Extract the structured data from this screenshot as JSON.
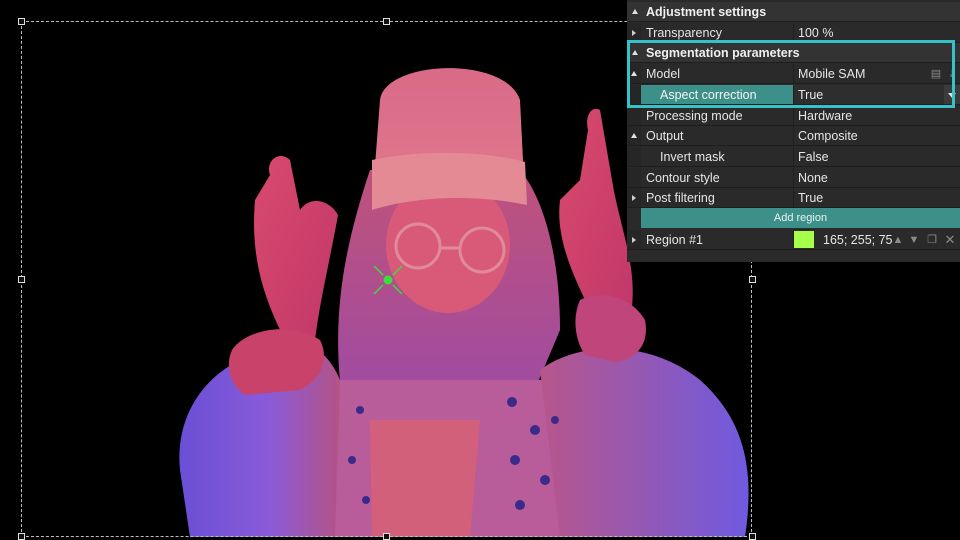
{
  "panel": {
    "sections": {
      "adjustment": "Adjustment settings",
      "segmentation": "Segmentation parameters"
    },
    "rows": {
      "transparency": {
        "label": "Transparency",
        "value": "100 %"
      },
      "model": {
        "label": "Model",
        "value": "Mobile SAM"
      },
      "aspect_correction": {
        "label": "Aspect correction",
        "value": "True"
      },
      "processing_mode": {
        "label": "Processing mode",
        "value": "Hardware"
      },
      "output": {
        "label": "Output",
        "value": "Composite"
      },
      "invert_mask": {
        "label": "Invert mask",
        "value": "False"
      },
      "contour_style": {
        "label": "Contour style",
        "value": "None"
      },
      "post_filtering": {
        "label": "Post filtering",
        "value": "True"
      }
    },
    "add_region_label": "Add region",
    "region": {
      "label": "Region #1",
      "value": "165; 255; 75",
      "color": "#a5ff4b"
    }
  },
  "colors": {
    "accent": "#3d8f8a",
    "highlight": "#35c3c9",
    "marker": "#3ddc3d"
  }
}
